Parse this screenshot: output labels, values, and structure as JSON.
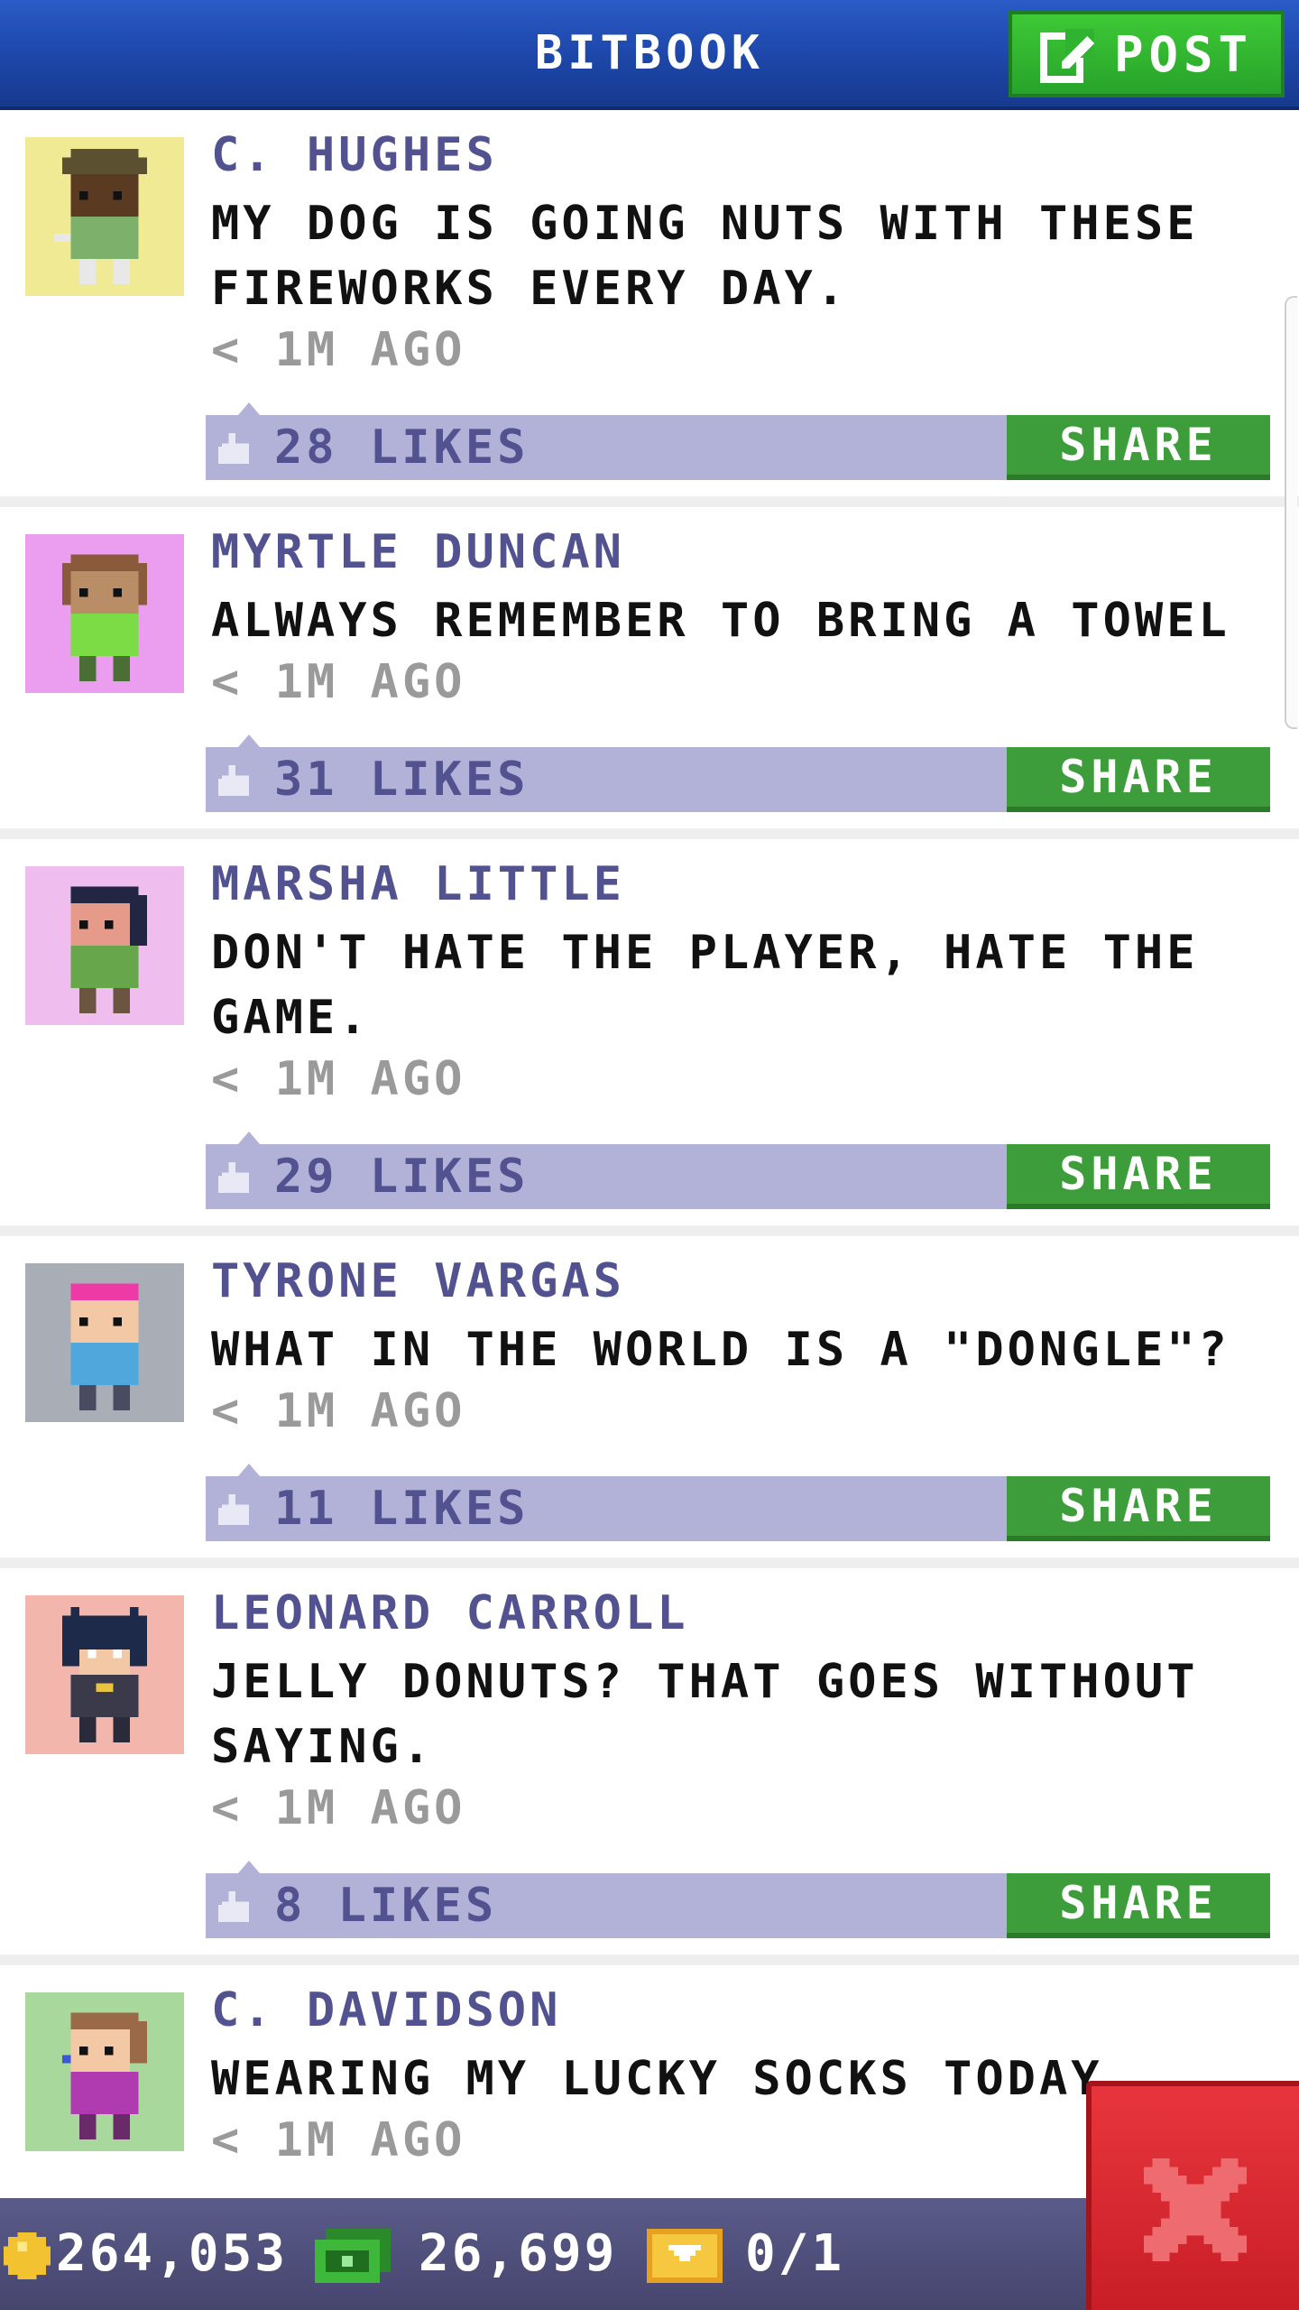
{
  "header": {
    "title": "BITBOOK",
    "post_label": "POST",
    "post_icon": "compose-icon"
  },
  "share_label": "SHARE",
  "posts": [
    {
      "author": "C. HUGHES",
      "message": "MY DOG IS GOING NUTS WITH THESE FIREWORKS EVERY DAY.",
      "time": "< 1M AGO",
      "likes": "28 LIKES",
      "avatar_bg": "#f1ea94",
      "avatar_colors": {
        "skin": "#5b3a22",
        "hair": "#3d2b1b",
        "hat": "#5b5030",
        "shirt": "#7db06a",
        "pants": "#e8e8e8"
      }
    },
    {
      "author": "MYRTLE DUNCAN",
      "message": "ALWAYS REMEMBER TO BRING A TOWEL",
      "time": "< 1M AGO",
      "likes": "31 LIKES",
      "avatar_bg": "#eb9ef0",
      "avatar_colors": {
        "skin": "#b98e66",
        "hair": "#8b5a3c",
        "hat": "#8b5a3c",
        "shirt": "#7bdc46",
        "pants": "#4a6e36"
      }
    },
    {
      "author": "MARSHA LITTLE",
      "message": "DON'T HATE THE PLAYER, HATE THE GAME.",
      "time": "< 1M AGO",
      "likes": "29 LIKES",
      "avatar_bg": "#efbeee",
      "avatar_colors": {
        "skin": "#e59a8a",
        "hair": "#232642",
        "hat": "#232642",
        "shirt": "#67a64a",
        "pants": "#6b5440"
      }
    },
    {
      "author": "TYRONE VARGAS",
      "message": "WHAT IN THE WORLD IS A \"DONGLE\"?",
      "time": "< 1M AGO",
      "likes": "11 LIKES",
      "avatar_bg": "#a9adb6",
      "avatar_colors": {
        "skin": "#f2c9a4",
        "hair": "#ee3aa5",
        "hat": "#ee3aa5",
        "shirt": "#4fa7dc",
        "pants": "#4a4a60"
      }
    },
    {
      "author": "LEONARD CARROLL",
      "message": "JELLY DONUTS? THAT GOES WITHOUT SAYING.",
      "time": "< 1M AGO",
      "likes": "8 LIKES",
      "avatar_bg": "#f2b6ac",
      "avatar_colors": {
        "skin": "#f2c9a4",
        "hair": "#1e2a4a",
        "hat": "#1e2a4a",
        "shirt": "#3a3a4a",
        "pants": "#2a2a3a"
      }
    },
    {
      "author": "C. DAVIDSON",
      "message": "WEARING MY LUCKY SOCKS TODAY",
      "time": "< 1M AGO",
      "likes": "",
      "avatar_bg": "#a9d89c",
      "avatar_colors": {
        "skin": "#f2c9a4",
        "hair": "#9a6a48",
        "hat": "#9a6a48",
        "shirt": "#b03ab0",
        "pants": "#6a2a6a"
      }
    }
  ],
  "footer": {
    "coins": "264,053",
    "cash": "26,699",
    "tickets": "0/1",
    "coin_icon": "coin-icon",
    "cash_icon": "cash-icon",
    "ticket_icon": "ticket-icon"
  },
  "close_icon": "close-icon",
  "colors": {
    "header_blue": "#1d46a8",
    "accent_green": "#3d9d3a",
    "likes_bar": "#b2b2d8",
    "author_purple": "#535290",
    "close_red": "#d9262e"
  }
}
